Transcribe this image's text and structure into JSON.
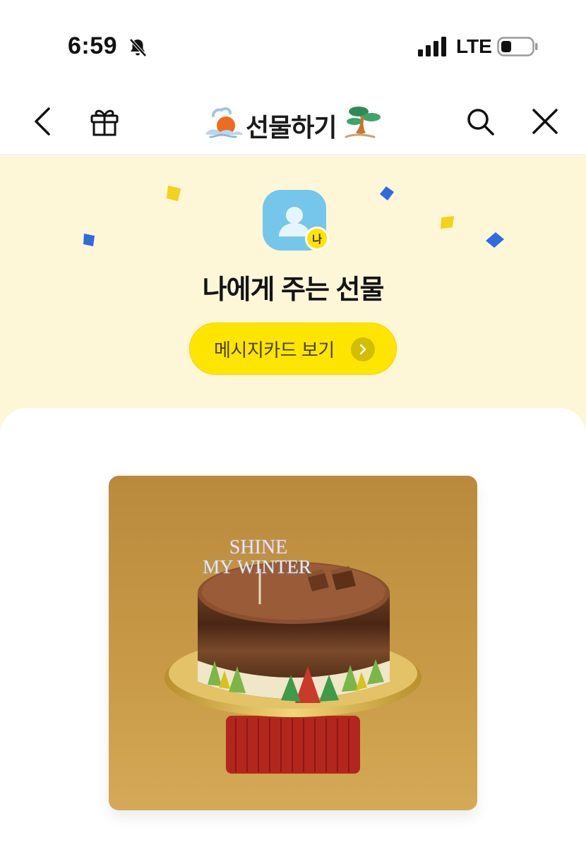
{
  "status_bar": {
    "time": "6:59",
    "network": "LTE",
    "icons": [
      "bell-muted-icon",
      "signal-icon",
      "battery-icon"
    ]
  },
  "header": {
    "title": "선물하기",
    "icons": [
      "back-arrow-icon",
      "gift-icon",
      "search-icon",
      "close-icon"
    ]
  },
  "banner": {
    "avatar_badge": "나",
    "title": "나에게 주는 선물",
    "message_button_label": "메시지카드 보기"
  },
  "product": {
    "topper_line1": "SHINE",
    "topper_line2": "MY WINTER"
  },
  "colors": {
    "accent_yellow": "#fee500",
    "banner_bg": "#fdf7d8",
    "avatar_blue": "#74c7ea"
  }
}
